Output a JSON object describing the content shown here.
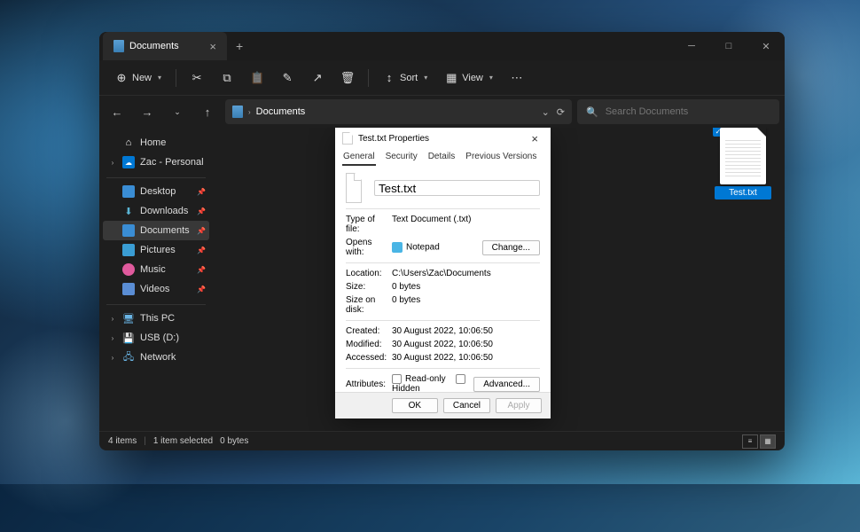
{
  "explorer": {
    "tab_title": "Documents",
    "toolbar": {
      "new": "New",
      "sort": "Sort",
      "view": "View"
    },
    "nav": {
      "breadcrumb": "Documents"
    },
    "search": {
      "placeholder": "Search Documents"
    },
    "sidebar": {
      "home": "Home",
      "onedrive": "Zac - Personal",
      "desktop": "Desktop",
      "downloads": "Downloads",
      "documents": "Documents",
      "pictures": "Pictures",
      "music": "Music",
      "videos": "Videos",
      "thispc": "This PC",
      "usb": "USB (D:)",
      "network": "Network"
    },
    "file": {
      "name": "Test.txt"
    },
    "status": {
      "count": "4 items",
      "selected": "1 item selected",
      "size": "0 bytes"
    }
  },
  "dialog": {
    "title": "Test.txt Properties",
    "tabs": {
      "general": "General",
      "security": "Security",
      "details": "Details",
      "previous": "Previous Versions"
    },
    "filename": "Test.txt",
    "rows": {
      "type_label": "Type of file:",
      "type_val": "Text Document (.txt)",
      "opens_label": "Opens with:",
      "opens_val": "Notepad",
      "change_btn": "Change...",
      "location_label": "Location:",
      "location_val": "C:\\Users\\Zac\\Documents",
      "size_label": "Size:",
      "size_val": "0 bytes",
      "sizedisk_label": "Size on disk:",
      "sizedisk_val": "0 bytes",
      "created_label": "Created:",
      "created_val": "30 August 2022, 10:06:50",
      "modified_label": "Modified:",
      "modified_val": "30 August 2022, 10:06:50",
      "accessed_label": "Accessed:",
      "accessed_val": "30 August 2022, 10:06:50",
      "attributes_label": "Attributes:",
      "readonly": "Read-only",
      "hidden": "Hidden",
      "advanced_btn": "Advanced..."
    },
    "footer": {
      "ok": "OK",
      "cancel": "Cancel",
      "apply": "Apply"
    }
  }
}
